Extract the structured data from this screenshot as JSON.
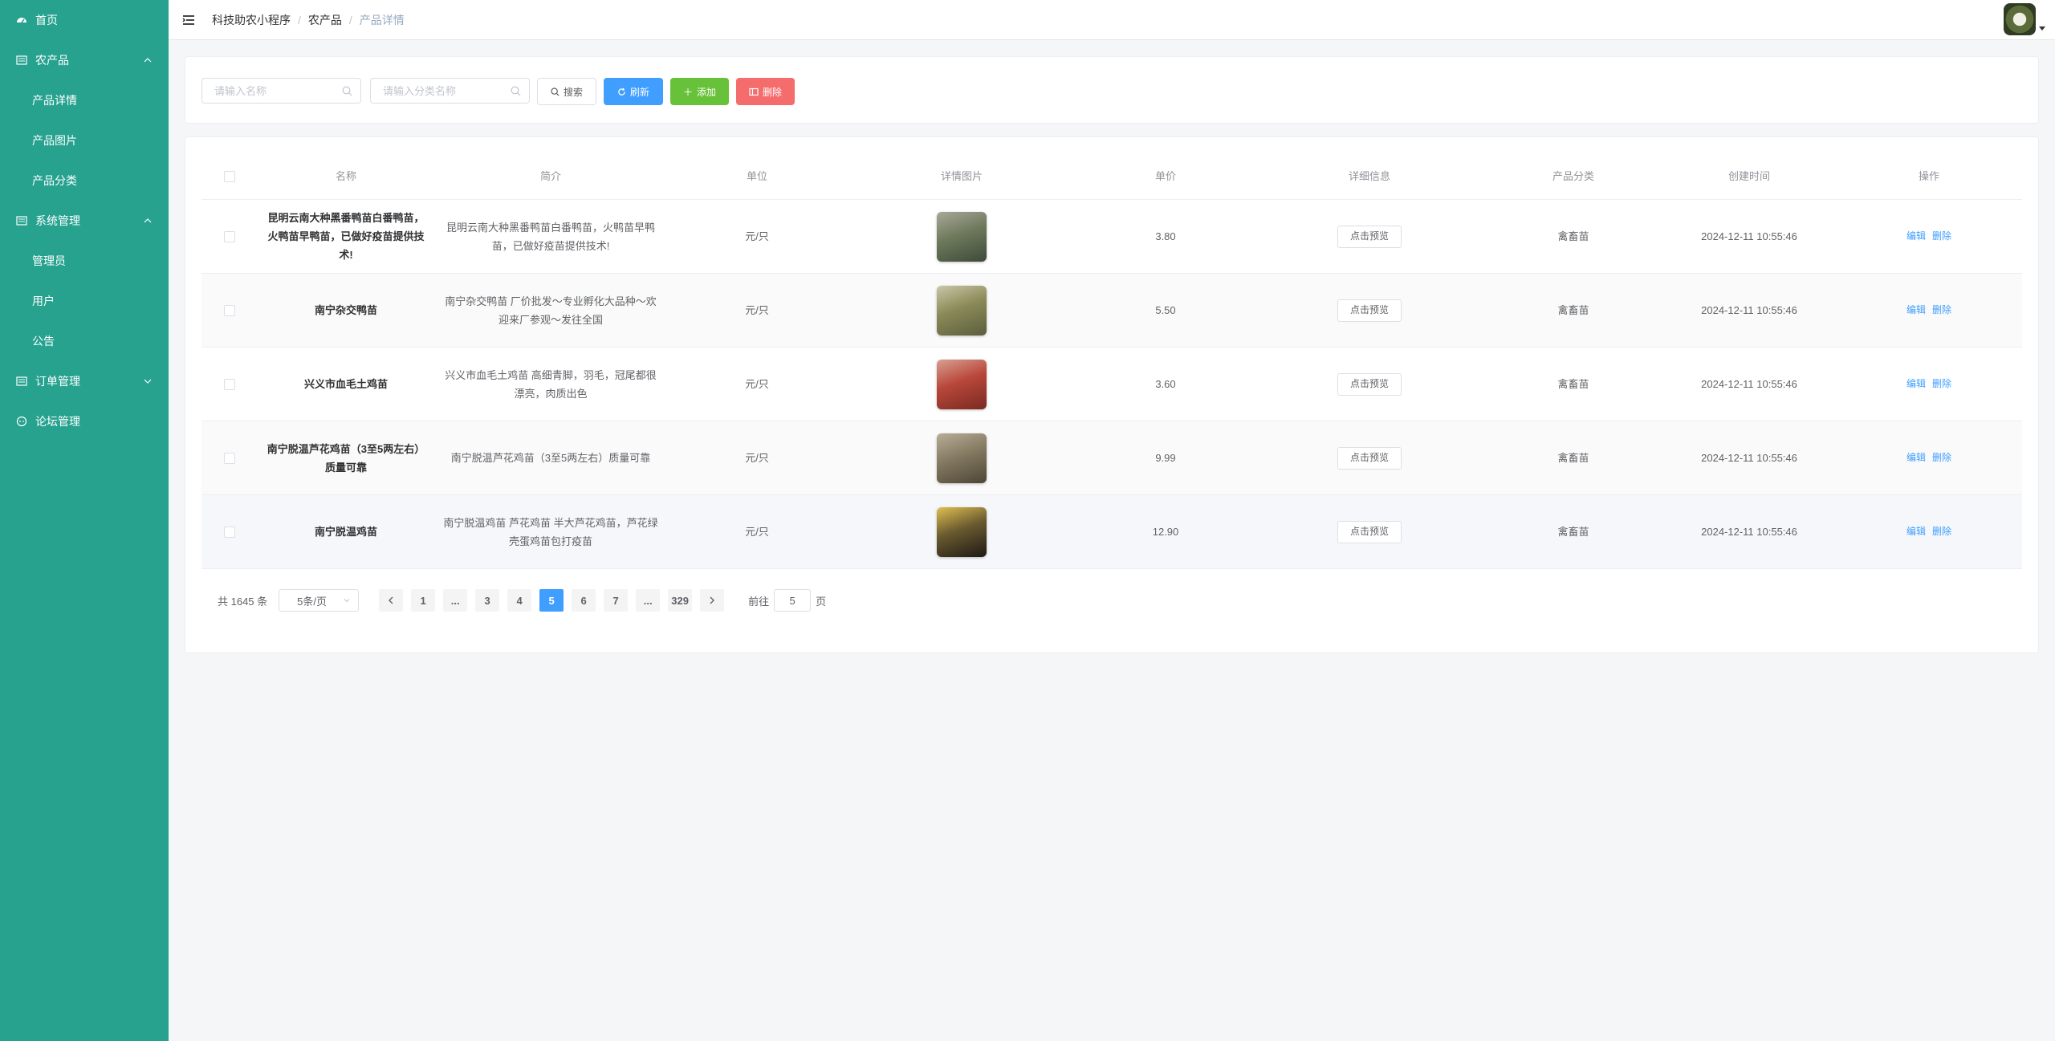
{
  "sidebar": {
    "items": [
      {
        "label": "首页",
        "icon": "dashboard-icon"
      },
      {
        "label": "农产品",
        "icon": "list-icon",
        "expanded": true
      },
      {
        "label": "产品详情"
      },
      {
        "label": "产品图片"
      },
      {
        "label": "产品分类"
      },
      {
        "label": "系统管理",
        "icon": "list-icon",
        "expanded": true
      },
      {
        "label": "管理员"
      },
      {
        "label": "用户"
      },
      {
        "label": "公告"
      },
      {
        "label": "订单管理",
        "icon": "list-icon",
        "expanded": false
      },
      {
        "label": "论坛管理",
        "icon": "chat-icon"
      }
    ],
    "bg_color": "#26a28f"
  },
  "header": {
    "breadcrumb": [
      "科技助农小程序",
      "农产品",
      "产品详情"
    ],
    "separator": "/"
  },
  "search": {
    "name_placeholder": "请输入名称",
    "category_placeholder": "请输入分类名称",
    "search_label": "搜索",
    "refresh_label": "刷新",
    "add_label": "添加",
    "delete_label": "删除"
  },
  "table": {
    "columns": [
      "名称",
      "简介",
      "单位",
      "详情图片",
      "单价",
      "详细信息",
      "产品分类",
      "创建时间",
      "操作"
    ],
    "preview_label": "点击预览",
    "edit_label": "编辑",
    "delete_label": "删除",
    "rows": [
      {
        "name": "昆明云南大种黑番鸭苗白番鸭苗，火鸭苗早鸭苗，已做好疫苗提供技术!",
        "intro": "昆明云南大种黑番鸭苗白番鸭苗，火鸭苗早鸭苗，已做好疫苗提供技术!",
        "unit": "元/只",
        "price": "3.80",
        "category": "禽畜苗",
        "created": "2024-12-11 10:55:46",
        "thumb_colors": [
          "#3d4a3a",
          "#6f7a5c",
          "#a9a89a"
        ]
      },
      {
        "name": "南宁杂交鸭苗",
        "intro": "南宁杂交鸭苗 厂价批发～专业孵化大品种～欢迎来厂参观～发往全国",
        "unit": "元/只",
        "price": "5.50",
        "category": "禽畜苗",
        "created": "2024-12-11 10:55:46",
        "thumb_colors": [
          "#5a5e3c",
          "#8b8a58",
          "#c9c7a8"
        ]
      },
      {
        "name": "兴义市血毛土鸡苗",
        "intro": "兴义市血毛土鸡苗 高细青脚，羽毛，冠尾都很漂亮，肉质出色",
        "unit": "元/只",
        "price": "3.60",
        "category": "禽畜苗",
        "created": "2024-12-11 10:55:46",
        "thumb_colors": [
          "#7a2a22",
          "#b8473a",
          "#d9a092"
        ]
      },
      {
        "name": "南宁脱温芦花鸡苗（3至5两左右）质量可靠",
        "intro": "南宁脱温芦花鸡苗（3至5两左右）质量可靠",
        "unit": "元/只",
        "price": "9.99",
        "category": "禽畜苗",
        "created": "2024-12-11 10:55:46",
        "thumb_colors": [
          "#4d4636",
          "#857a62",
          "#b8ae98"
        ]
      },
      {
        "name": "南宁脱温鸡苗",
        "intro": "南宁脱温鸡苗 芦花鸡苗 半大芦花鸡苗，芦花绿壳蛋鸡苗包打疫苗",
        "unit": "元/只",
        "price": "12.90",
        "category": "禽畜苗",
        "created": "2024-12-11 10:55:46",
        "thumb_colors": [
          "#1e1a14",
          "#6a5a30",
          "#e0c050"
        ]
      }
    ]
  },
  "pagination": {
    "total_text": "共 1645 条",
    "page_size": "5条/页",
    "pages": [
      "1",
      "...",
      "3",
      "4",
      "5",
      "6",
      "7",
      "...",
      "329"
    ],
    "current": "5",
    "goto_label": "前往",
    "goto_value": "5",
    "page_suffix": "页"
  },
  "colors": {
    "primary": "#409eff",
    "success": "#67c23a",
    "danger": "#f56c6c"
  }
}
